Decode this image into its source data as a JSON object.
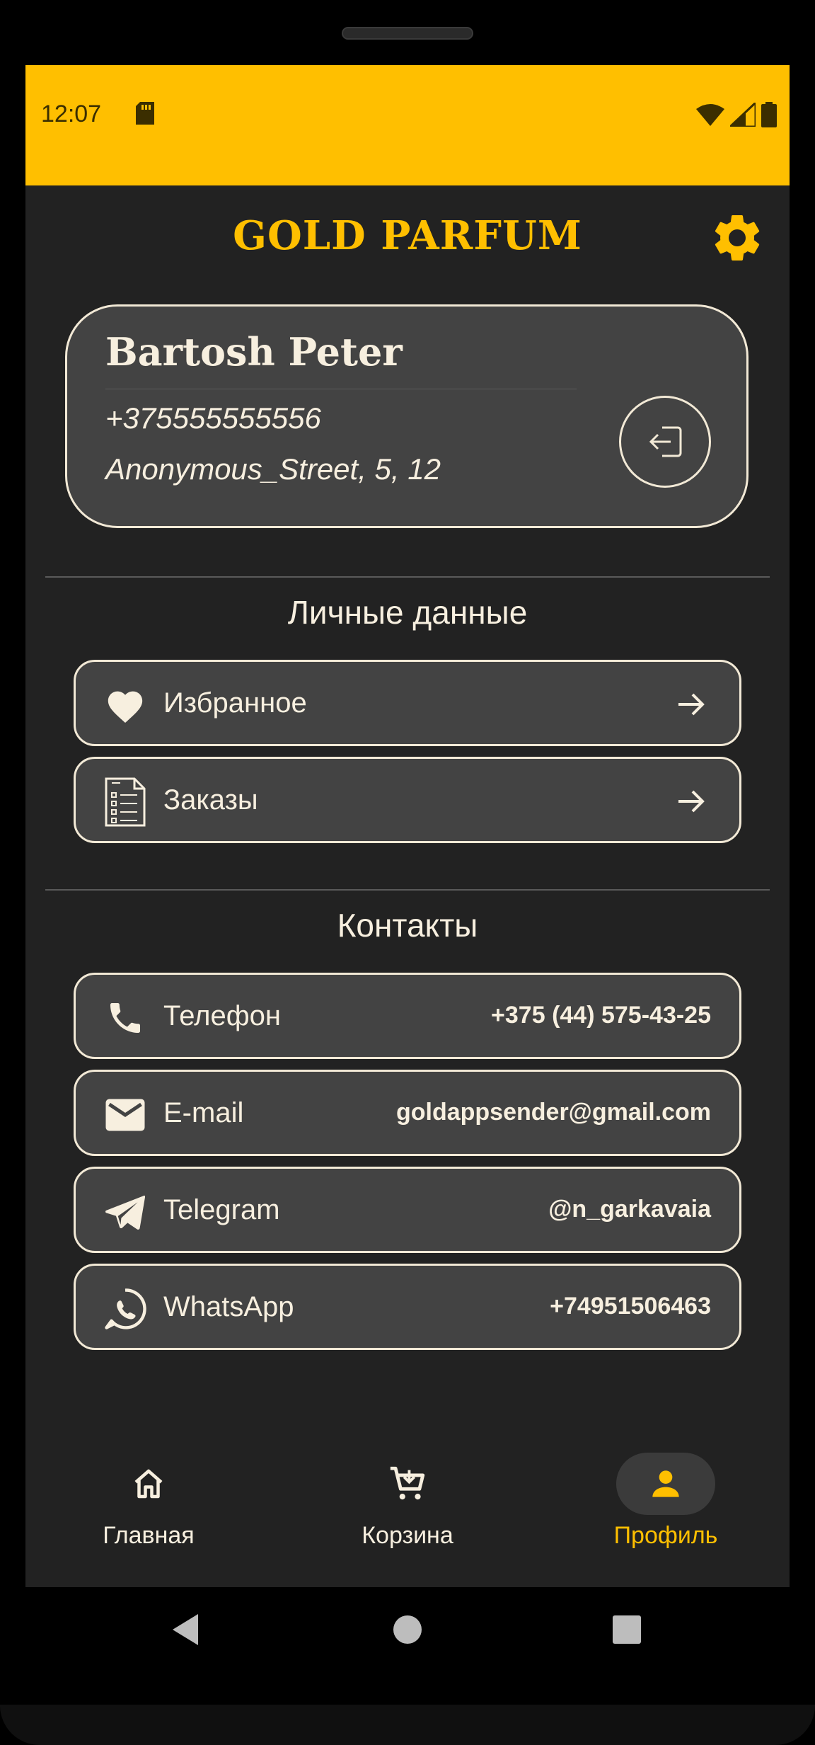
{
  "status_bar": {
    "time": "12:07",
    "background_color": "#FFBF00"
  },
  "header": {
    "title": "GOLD PARFUM",
    "settings_icon": "gear-icon",
    "accent_color": "#FFBF00"
  },
  "profile": {
    "name": "Bartosh Peter",
    "phone": "+375555555556",
    "address": "Anonymous_Street, 5, 12",
    "logout_icon": "logout-icon"
  },
  "personal": {
    "title": "Личные данные",
    "items": [
      {
        "label": "Избранное",
        "icon": "heart-icon"
      },
      {
        "label": "Заказы",
        "icon": "document-list-icon"
      }
    ]
  },
  "contacts": {
    "title": "Контакты",
    "items": [
      {
        "label": "Телефон",
        "value": "+375 (44) 575-43-25",
        "icon": "phone-icon"
      },
      {
        "label": "E-mail",
        "value": "goldappsender@gmail.com",
        "icon": "mail-icon"
      },
      {
        "label": "Telegram",
        "value": "@n_garkavaia",
        "icon": "telegram-icon"
      },
      {
        "label": "WhatsApp",
        "value": "+74951506463",
        "icon": "whatsapp-icon"
      }
    ]
  },
  "bottom_nav": {
    "items": [
      {
        "label": "Главная",
        "icon": "home-icon",
        "active": false
      },
      {
        "label": "Корзина",
        "icon": "cart-icon",
        "active": false
      },
      {
        "label": "Профиль",
        "icon": "person-icon",
        "active": true
      }
    ]
  }
}
